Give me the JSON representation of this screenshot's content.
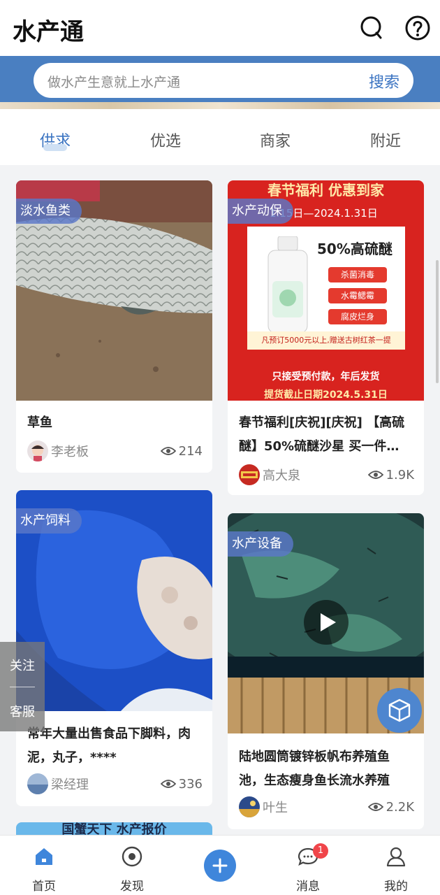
{
  "header": {
    "title": "水产通"
  },
  "search": {
    "placeholder": "做水产生意就上水产通",
    "button_label": "搜索"
  },
  "tabs": [
    {
      "label": "供求",
      "active": true
    },
    {
      "label": "优选",
      "active": false
    },
    {
      "label": "商家",
      "active": false
    },
    {
      "label": "附近",
      "active": false
    }
  ],
  "cards": [
    {
      "tag": "淡水鱼类",
      "title_lines": [
        "草鱼"
      ],
      "author": "李老板",
      "views": "214"
    },
    {
      "tag": "水产动保",
      "title_lines": [
        "春节福利[庆祝][庆祝] 【高硫",
        "醚】50%硫醚沙星 买一件…"
      ],
      "author": "高大泉",
      "views": "1.9K",
      "poster": {
        "headline": "春节福利 优惠到家",
        "dates": "1.15日—2024.1.31日",
        "product": "50%高硫醚",
        "features": [
          "杀菌消毒",
          "水霉鳃霉",
          "腐皮烂身"
        ],
        "offer": "凡预订5000元以上,赠送古树红茶一提",
        "footer_1": "只接受预付款，年后发货",
        "footer_2": "提货截止日期2024.5.31日"
      }
    },
    {
      "tag": "水产饲料",
      "title_lines": [
        "常年大量出售食品下脚料，肉",
        "泥，丸子，****"
      ],
      "author": "梁经理",
      "views": "336"
    },
    {
      "tag": "水产设备",
      "title_lines": [
        "陆地圆筒镀锌板帆布养殖鱼",
        "池，生态瘦身鱼长流水养殖"
      ],
      "author": "叶生",
      "views": "2.2K"
    }
  ],
  "partial_card": {
    "banner_text": "国蟹天下 水产报价"
  },
  "side_float": {
    "follow_label": "关注",
    "service_label": "客服"
  },
  "bottom_nav": [
    {
      "label": "首页",
      "icon": "home-icon",
      "active": true
    },
    {
      "label": "发现",
      "icon": "discover-icon",
      "active": false
    },
    {
      "label": "消息",
      "icon": "message-icon",
      "active": false,
      "badge": "1"
    },
    {
      "label": "我的",
      "icon": "profile-icon",
      "active": false
    }
  ],
  "colors": {
    "brand_blue": "#3b74c2",
    "search_band": "#4a7fc1",
    "badge_red": "#f0454a",
    "poster_red": "#d8231f"
  }
}
